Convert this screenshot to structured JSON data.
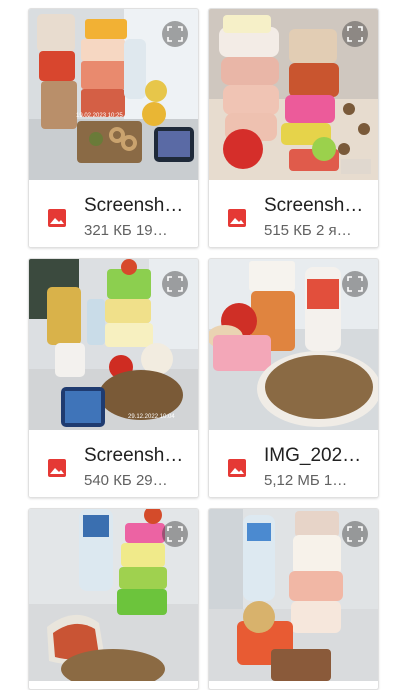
{
  "colors": {
    "accent_red": "#e53935",
    "text_primary": "#212121",
    "text_secondary": "#616161"
  },
  "icons": {
    "file_type": "image-file-icon",
    "expand": "expand-icon"
  },
  "cards": [
    {
      "name": "Screensh…",
      "meta": "321 КБ 19…",
      "photo_stamp": "19.02.2023 10:25"
    },
    {
      "name": "Screensh…",
      "meta": "515 КБ 2 я…"
    },
    {
      "name": "Screensh…",
      "meta": "540 КБ 29…",
      "photo_stamp": "29.12.2022 10:04"
    },
    {
      "name": "IMG_202…",
      "meta": "5,12 МБ 1…"
    },
    {
      "name": "",
      "meta": ""
    },
    {
      "name": "",
      "meta": ""
    }
  ]
}
